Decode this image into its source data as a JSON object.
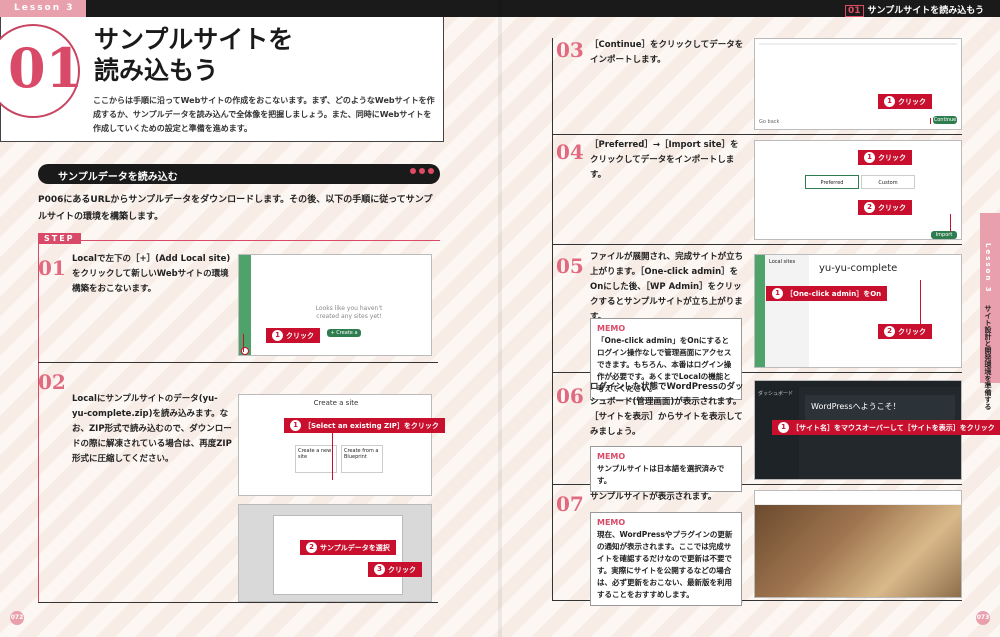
{
  "header": {
    "lesson_label": "Lesson 3",
    "right_header_num": "01",
    "right_header_title": "サンプルサイトを読み込もう"
  },
  "title": {
    "number": "01",
    "line1": "サンプルサイトを",
    "line2": "読み込もう"
  },
  "intro": "ここからは手順に沿ってWebサイトの作成をおこないます。まず、どのようなWebサイトを作成するか、サンプルデータを読み込んで全体像を把握しましょう。また、同時にWebサイトを作成していくための設定と準備を進めます。",
  "section": {
    "title": "サンプルデータを読み込む",
    "text": "P006にあるURLからサンプルデータをダウンロードします。その後、以下の手順に従ってサンプルサイトの環境を構築します。"
  },
  "step_label": "STEP",
  "steps": [
    {
      "num": "01",
      "text": "Localで左下の［+］(Add Local site)をクリックして新しいWebサイトの環境構築をおこないます。"
    },
    {
      "num": "02",
      "text": "Localにサンプルサイトのデータ(yu-yu-complete.zip)を読み込みます。なお、ZIP形式で読み込むので、ダウンロードの際に解凍されている場合は、再度ZIP形式に圧縮してください。"
    },
    {
      "num": "03",
      "text": "［Continue］をクリックしてデータをインポートします。"
    },
    {
      "num": "04",
      "text": "［Preferred］→［Import site］をクリックしてデータをインポートします。"
    },
    {
      "num": "05",
      "text": "ファイルが展開され、完成サイトが立ち上がります。［One-click admin］をOnにした後、［WP Admin］をクリックするとサンプルサイトが立ち上がります。"
    },
    {
      "num": "06",
      "text": "ログインした状態でWordPressのダッシュボード(管理画面)が表示されます。［サイトを表示］からサイトを表示してみましょう。"
    },
    {
      "num": "07",
      "text": "サンプルサイトが表示されます。"
    }
  ],
  "memos": {
    "label": "MEMO",
    "memo5": "「One-click admin」をOnにするとログイン操作なしで管理画面にアクセスできます。もちろん、本番はログイン操作が必要です。あくまでLocalの機能と考えてください。",
    "memo6": "サンプルサイトは日本語を選択済みです。",
    "memo7": "現在、WordPressやプラグインの更新の通知が表示されます。ここでは完成サイトを確認するだけなので更新は不要です。実際にサイトを公開するなどの場合は、必ず更新をおこない、最新版を利用することをおすすめします。"
  },
  "callouts": {
    "s1": {
      "n": "1",
      "label": "クリック"
    },
    "s2a": {
      "n": "1",
      "label": "［Select an existing ZIP］をクリック"
    },
    "s2b": {
      "n": "2",
      "label": "サンプルデータを選択"
    },
    "s2c": {
      "n": "3",
      "label": "クリック"
    },
    "s3": {
      "n": "1",
      "label": "クリック"
    },
    "s4a": {
      "n": "1",
      "label": "クリック"
    },
    "s4b": {
      "n": "2",
      "label": "クリック"
    },
    "s5a": {
      "n": "1",
      "label": "［One-click admin］をOn"
    },
    "s5b": {
      "n": "2",
      "label": "クリック"
    },
    "s6": {
      "n": "1",
      "label": "［サイト名］をマウスオーバーして［サイトを表示］をクリック"
    }
  },
  "screens": {
    "s1_empty": "Looks like you haven't created any sites yet!",
    "s1_button": "+ Create a new site",
    "s2_title": "Create a site",
    "s2_opt1": "Create a new site",
    "s2_opt2": "Create from a Blueprint",
    "s3_button": "Continue",
    "s3_back": "Go back",
    "s4_opt1": "Preferred",
    "s4_opt2": "Custom",
    "s4_button": "Import site",
    "s5_site": "yu-yu-complete",
    "s5_list_title": "Local sites",
    "s6_welcome": "WordPressへようこそ！",
    "s6_menu": "ダッシュボード"
  },
  "sidebar": {
    "tab": "Lesson 3",
    "text": "サイト設計と開発環境を準備する"
  },
  "pages": {
    "left": "072",
    "right": "073"
  }
}
